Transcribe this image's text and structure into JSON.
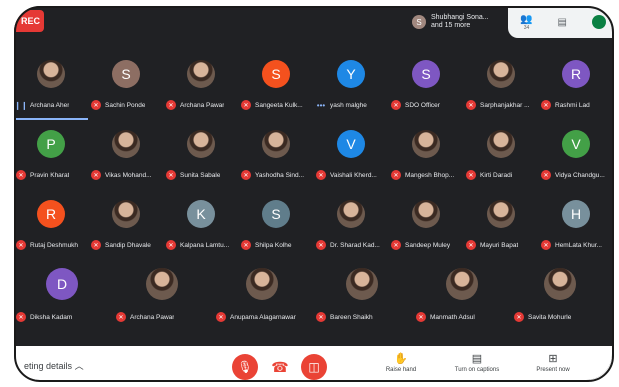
{
  "top": {
    "rec_label": "REC",
    "presenter_initial": "S",
    "presenter_line1": "Shubhangi Sona...",
    "presenter_line2": "and 15 more",
    "people_count": "34"
  },
  "rows": [
    [
      {
        "name": "Archana Aher",
        "initial": "",
        "color": "photo",
        "mic": "live"
      },
      {
        "name": "Sachin Ponde",
        "initial": "S",
        "color": "#8d6e63",
        "mic": "muted"
      },
      {
        "name": "Archana Pawar",
        "initial": "",
        "color": "photo",
        "mic": "muted"
      },
      {
        "name": "Sangeeta Kulk...",
        "initial": "S",
        "color": "#f4511e",
        "mic": "muted"
      },
      {
        "name": "yash malghe",
        "initial": "Y",
        "color": "#1e88e5",
        "mic": "dots"
      },
      {
        "name": "SDO Officer",
        "initial": "S",
        "color": "#7e57c2",
        "mic": "muted"
      },
      {
        "name": "Sarphanjakhar ...",
        "initial": "",
        "color": "photo",
        "mic": "muted"
      },
      {
        "name": "Rashmi Lad",
        "initial": "R",
        "color": "#7e57c2",
        "mic": "muted"
      }
    ],
    [
      {
        "name": "Pravin Kharat",
        "initial": "P",
        "color": "#43a047",
        "mic": "muted"
      },
      {
        "name": "Vikas Mohand...",
        "initial": "",
        "color": "photo",
        "mic": "muted"
      },
      {
        "name": "Sunita Sabale",
        "initial": "",
        "color": "photo",
        "mic": "muted"
      },
      {
        "name": "Yashodha Sind...",
        "initial": "",
        "color": "photo",
        "mic": "muted"
      },
      {
        "name": "Vaishali Kherd...",
        "initial": "V",
        "color": "#1e88e5",
        "mic": "muted"
      },
      {
        "name": "Mangesh Bhop...",
        "initial": "",
        "color": "photo",
        "mic": "muted"
      },
      {
        "name": "Kirti Daradi",
        "initial": "",
        "color": "photo",
        "mic": "muted"
      },
      {
        "name": "Vidya Chandgu...",
        "initial": "V",
        "color": "#43a047",
        "mic": "muted"
      }
    ],
    [
      {
        "name": "Rutaj Deshmukh",
        "initial": "R",
        "color": "#f4511e",
        "mic": "muted"
      },
      {
        "name": "Sandip Dhavale",
        "initial": "",
        "color": "photo",
        "mic": "muted"
      },
      {
        "name": "Kalpana Lamtu...",
        "initial": "K",
        "color": "#78909c",
        "mic": "muted"
      },
      {
        "name": "Shilpa Kolhe",
        "initial": "S",
        "color": "#607d8b",
        "mic": "muted"
      },
      {
        "name": "Dr. Sharad Kad...",
        "initial": "",
        "color": "photo",
        "mic": "muted"
      },
      {
        "name": "Sandeep Muley",
        "initial": "",
        "color": "photo",
        "mic": "muted"
      },
      {
        "name": "Mayuri Bapat",
        "initial": "",
        "color": "photo",
        "mic": "muted"
      },
      {
        "name": "HemLata Khur...",
        "initial": "H",
        "color": "#78909c",
        "mic": "muted"
      }
    ],
    [
      {
        "name": "Diksha Kadam",
        "initial": "D",
        "color": "#7e57c2",
        "mic": "muted"
      },
      {
        "name": "Archana Pawar",
        "initial": "",
        "color": "photo",
        "mic": "muted"
      },
      {
        "name": "Anupama Alagarnawar",
        "initial": "",
        "color": "photo",
        "mic": "muted"
      },
      {
        "name": "Bareen Shaikh",
        "initial": "",
        "color": "photo",
        "mic": "muted"
      },
      {
        "name": "Manmath Adsul",
        "initial": "",
        "color": "photo",
        "mic": "muted"
      },
      {
        "name": "Savita Mohurle",
        "initial": "",
        "color": "photo",
        "mic": "muted"
      }
    ]
  ],
  "bottom": {
    "meeting_details": "eting details",
    "raise_hand": "Raise hand",
    "captions": "Turn on captions",
    "present": "Present now"
  }
}
